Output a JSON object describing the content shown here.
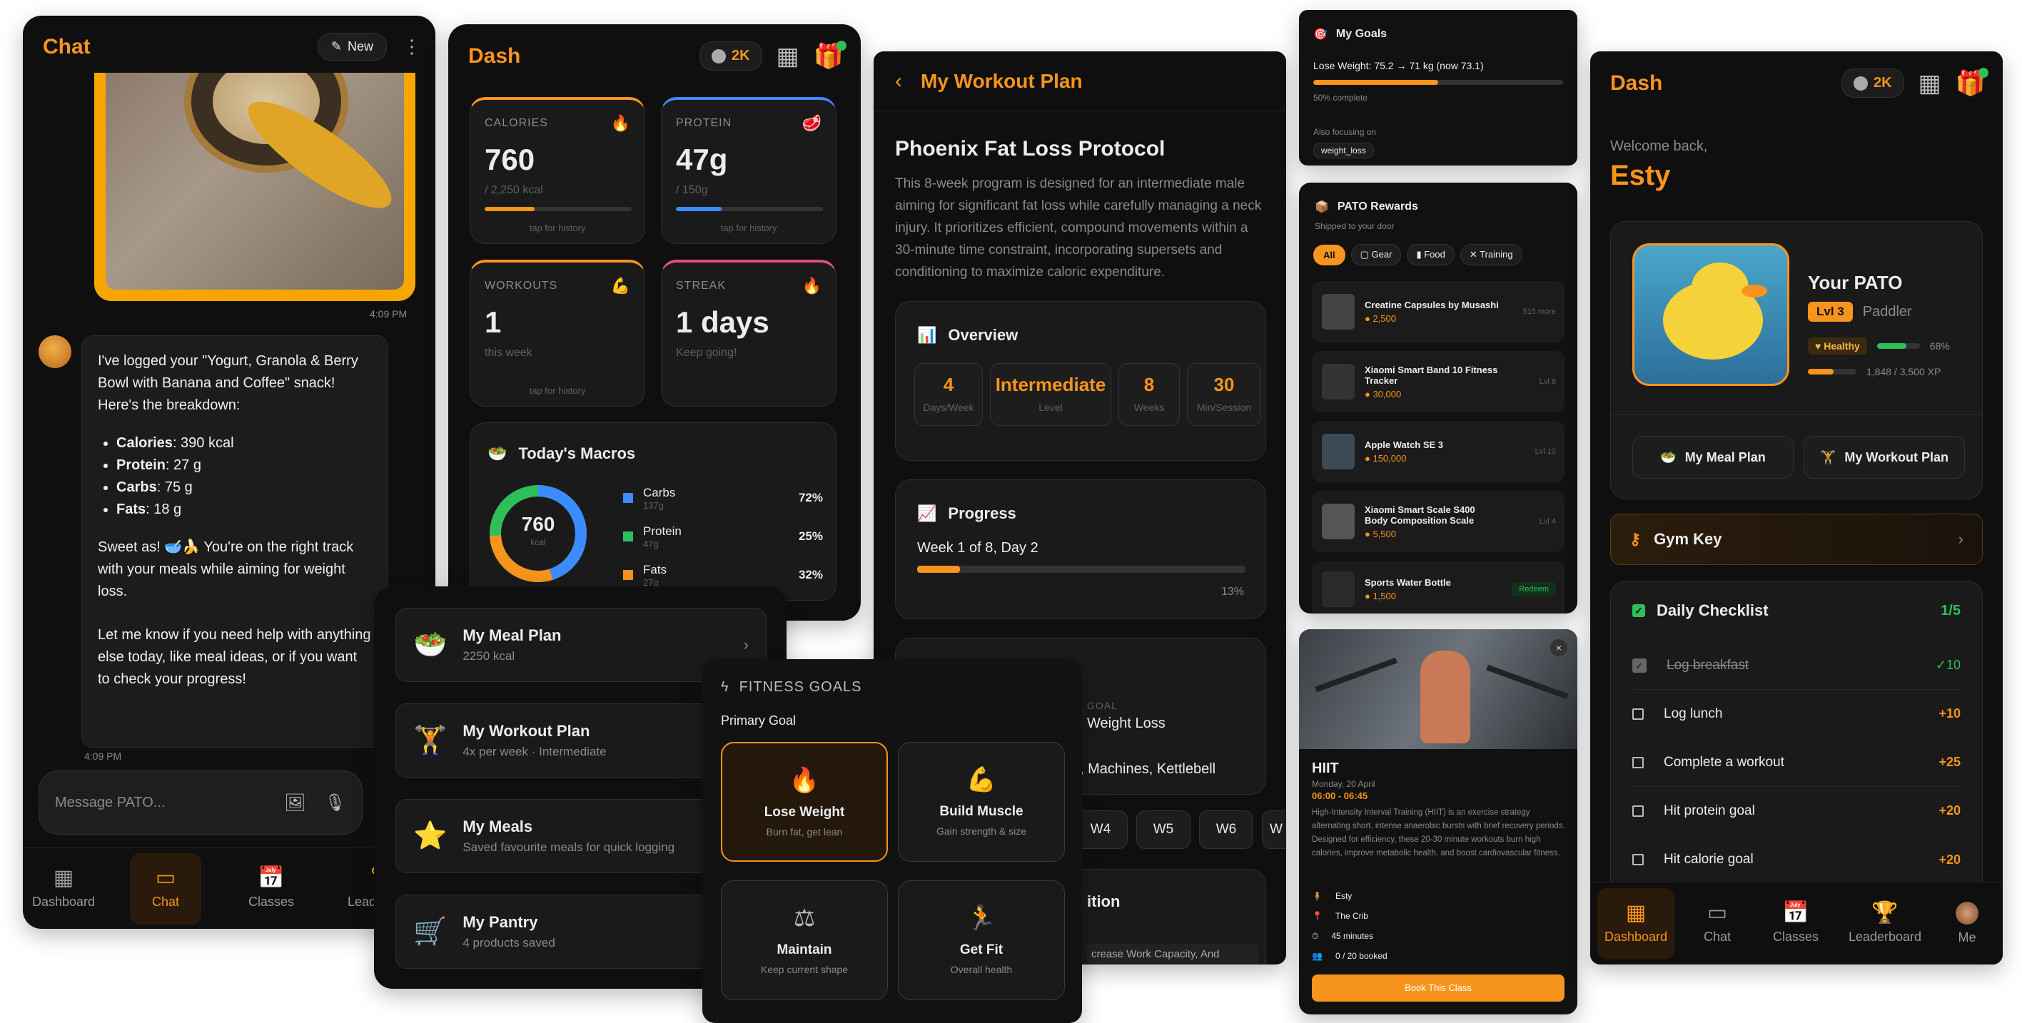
{
  "chat": {
    "title": "Chat",
    "new_label": "New",
    "menu_icon": "⋮",
    "time1": "4:09 PM",
    "intro": "I've logged your \"Yogurt, Granola & Berry Bowl with Banana and Coffee\" snack! Here's the breakdown:",
    "macros": [
      {
        "k": "Calories",
        "v": ": 390 kcal"
      },
      {
        "k": "Protein",
        "v": ": 27 g"
      },
      {
        "k": "Carbs",
        "v": ": 75 g"
      },
      {
        "k": "Fats",
        "v": ": 18 g"
      }
    ],
    "para2": "Sweet as! 🥣🍌 You're on the right track with your meals while aiming for weight loss.",
    "para3": "Let me know if you need help with anything else today, like meal ideas, or if you want to check your progress!",
    "time2": "4:09 PM",
    "input_placeholder": "Message PATO...",
    "nav": [
      "Dashboard",
      "Chat",
      "Classes",
      "Leaderboard"
    ]
  },
  "dash1": {
    "title": "Dash",
    "coins": "2K",
    "tiles": [
      {
        "label": "CALORIES",
        "value": "760",
        "sub": "/ 2,250 kcal",
        "hint": "tap for history",
        "icon": "🔥",
        "color": "#f7941d",
        "progress": 0.34
      },
      {
        "label": "PROTEIN",
        "value": "47g",
        "sub": "/ 150g",
        "hint": "tap for history",
        "icon": "🥩",
        "color": "#3a8cff",
        "progress": 0.31
      },
      {
        "label": "WORKOUTS",
        "value": "1",
        "sub": "this week",
        "hint": "tap for history",
        "icon": "💪",
        "color": "#f7941d"
      },
      {
        "label": "STREAK",
        "value": "1 days",
        "sub": "Keep going!",
        "hint": "",
        "icon": "🔥",
        "color": "#e04f8c"
      }
    ],
    "macros_title": "Today's Macros",
    "donut_value": "760",
    "donut_unit": "kcal",
    "macros": [
      {
        "name": "Carbs",
        "grams": "137g",
        "pct": "72%",
        "color": "#3a8cff"
      },
      {
        "name": "Protein",
        "grams": "47g",
        "pct": "25%",
        "color": "#2fbf5a"
      },
      {
        "name": "Fats",
        "grams": "27g",
        "pct": "32%",
        "color": "#f7941d"
      }
    ]
  },
  "menu": {
    "items": [
      {
        "title": "My Meal Plan",
        "sub": "2250 kcal",
        "icon": "🥗"
      },
      {
        "title": "My Workout Plan",
        "sub": "4x per week · Intermediate",
        "icon": "🏋️"
      },
      {
        "title": "My Meals",
        "sub": "Saved favourite meals for quick logging",
        "icon": "⭐"
      },
      {
        "title": "My Pantry",
        "sub": "4 products saved",
        "icon": "🛒"
      }
    ]
  },
  "goals": {
    "title": "FITNESS GOALS",
    "primary": "Primary Goal",
    "options": [
      {
        "title": "Lose Weight",
        "sub": "Burn fat, get lean",
        "icon": "🔥",
        "selected": true
      },
      {
        "title": "Build Muscle",
        "sub": "Gain strength & size",
        "icon": "💪",
        "selected": false
      },
      {
        "title": "Maintain",
        "sub": "Keep current shape",
        "icon": "⚖",
        "selected": false
      },
      {
        "title": "Get Fit",
        "sub": "Overall health",
        "icon": "🏃",
        "selected": false
      }
    ]
  },
  "plan": {
    "title": "My Workout Plan",
    "program": "Phoenix Fat Loss Protocol",
    "desc": "This 8-week program is designed for an intermediate male aiming for significant fat loss while carefully managing a neck injury. It prioritizes efficient, compound movements within a 30-minute time constraint, incorporating supersets and conditioning to maximize caloric expenditure.",
    "overview": "Overview",
    "stats": [
      {
        "v": "4",
        "l": "Days/Week"
      },
      {
        "v": "Intermediate",
        "l": "Level"
      },
      {
        "v": "8",
        "l": "Weeks"
      },
      {
        "v": "30",
        "l": "Min/Session"
      }
    ],
    "progress_title": "Progress",
    "progress_label": "Week 1 of 8, Day 2",
    "progress_pct": "13%",
    "progress": 0.13,
    "goal_label": "GOAL",
    "goal_value": "Weight Loss",
    "equipment": ", Machines, Kettlebell",
    "weeks": [
      "W4",
      "W5",
      "W6",
      "W"
    ],
    "nutrition": "ition",
    "phase": "crease Work Capacity, And"
  },
  "mygoals": {
    "title": "My Goals",
    "goal": "Lose Weight: 75.2 → 71 kg (now 73.1)",
    "complete": "50% complete",
    "progress": 0.5,
    "also": "Also focusing on",
    "tag": "weight_loss"
  },
  "rewards": {
    "title": "PATO Rewards",
    "sub": "Shipped to your door",
    "filters": [
      "All",
      "Gear",
      "Food",
      "Training"
    ],
    "items": [
      {
        "name": "Creatine Capsules by Musashi",
        "price": "2,500",
        "status": "515 more",
        "redeem": false
      },
      {
        "name": "Xiaomi Smart Band 10 Fitness Tracker",
        "price": "30,000",
        "status": "Lvl 8",
        "redeem": false
      },
      {
        "name": "Apple Watch SE 3",
        "price": "150,000",
        "status": "Lvl 10",
        "redeem": false
      },
      {
        "name": "Xiaomi Smart Scale S400 Body Composition Scale",
        "price": "5,500",
        "status": "Lvl 4",
        "redeem": false
      },
      {
        "name": "Sports Water Bottle",
        "price": "1,500",
        "status": "Redeem",
        "redeem": true
      }
    ]
  },
  "cls": {
    "name": "HIIT",
    "date": "Monday, 20 April",
    "time": "06:00 - 06:45",
    "desc": "High-Intensity Interval Training (HIIT) is an exercise strategy alternating short, intense anaerobic bursts with brief recovery periods. Designed for efficiency, these 20-30 minute workouts burn high calories, improve metabolic health, and boost cardiovascular fitness.",
    "details": [
      {
        "icon": "🧍",
        "t": "Esty"
      },
      {
        "icon": "📍",
        "t": "The Crib"
      },
      {
        "icon": "⏱",
        "t": "45 minutes"
      },
      {
        "icon": "👥",
        "t": "0 / 20 booked"
      }
    ],
    "book": "Book This Class"
  },
  "dash2": {
    "title": "Dash",
    "coins": "2K",
    "welcome": "Welcome back,",
    "name": "Esty",
    "pato_title": "Your PATO",
    "lvl": "Lvl 3",
    "rank": "Paddler",
    "health": "Healthy",
    "health_pct": "68%",
    "health_val": 0.68,
    "xp": "1,848 / 3,500 XP",
    "xp_val": 0.53,
    "meal_btn": "My Meal Plan",
    "workout_btn": "My Workout Plan",
    "gym_key": "Gym Key",
    "checklist_title": "Daily Checklist",
    "checklist_count": "1/5",
    "checklist": [
      {
        "t": "Log breakfast",
        "pts": "✓10",
        "done": true
      },
      {
        "t": "Log lunch",
        "pts": "+10",
        "done": false
      },
      {
        "t": "Complete a workout",
        "pts": "+25",
        "done": false
      },
      {
        "t": "Hit protein goal",
        "pts": "+20",
        "done": false
      },
      {
        "t": "Hit calorie goal",
        "pts": "+20",
        "done": false
      }
    ],
    "nav": [
      "Dashboard",
      "Chat",
      "Classes",
      "Leaderboard",
      "Me"
    ]
  }
}
